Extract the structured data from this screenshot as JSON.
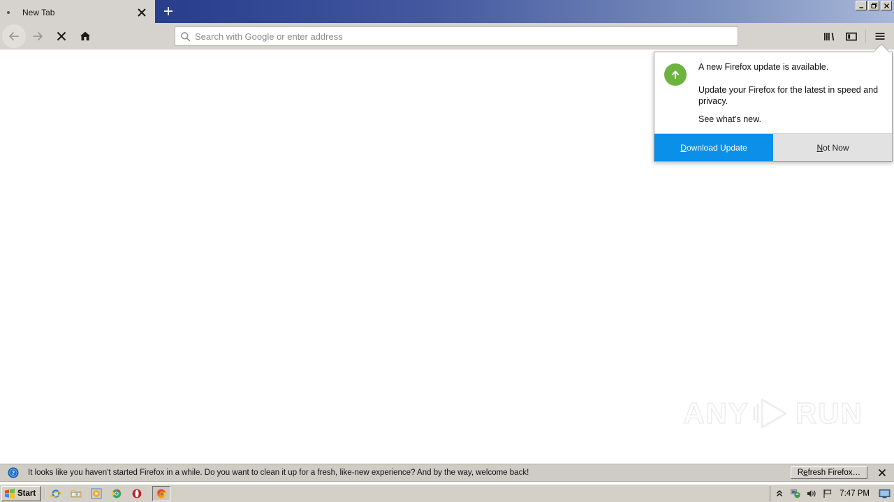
{
  "window": {
    "controls": {
      "minimize": "_",
      "restore": "❐",
      "close": "✕"
    }
  },
  "tabbar": {
    "tabs": [
      {
        "title": "New Tab",
        "close_label": "✕"
      }
    ],
    "new_tab_label": "+"
  },
  "toolbar": {
    "back_label": "Back",
    "forward_label": "Forward",
    "stop_label": "Stop",
    "home_label": "Home",
    "library_label": "Library",
    "sidebar_label": "Sidebars",
    "menu_label": "Open menu"
  },
  "urlbar": {
    "value": "",
    "placeholder": "Search with Google or enter address",
    "icon": "search-icon"
  },
  "update_popup": {
    "icon": "update-arrow-icon",
    "heading": "A new Firefox update is available.",
    "description": "Update your Firefox for the latest in speed and privacy.",
    "link": "See what's new.",
    "primary_button": {
      "prefix": "D",
      "rest": "ownload Update"
    },
    "secondary_button": {
      "prefix": "N",
      "rest": "ot Now"
    },
    "accent_color": "#0a90e8",
    "icon_color": "#6cb33f"
  },
  "notification_bar": {
    "icon": "help-question-icon",
    "message": "It looks like you haven't started Firefox in a while. Do you want to clean it up for a fresh, like-new experience? And by the way, welcome back!",
    "action_button": {
      "prefix": "R",
      "mid": "e",
      "rest": "fresh Firefox…"
    },
    "close_label": "✕"
  },
  "watermark": {
    "left_text": "ANY",
    "right_text": "RUN"
  },
  "taskbar": {
    "start_label": "Start",
    "quick_launch": [
      {
        "name": "internet-explorer-icon"
      },
      {
        "name": "folder-explorer-icon"
      },
      {
        "name": "media-player-icon"
      },
      {
        "name": "chrome-icon"
      },
      {
        "name": "opera-icon"
      }
    ],
    "task_buttons": [
      {
        "name": "firefox-taskbar-button"
      }
    ],
    "tray": {
      "chevron": "«",
      "icons": [
        {
          "name": "network-icon"
        },
        {
          "name": "volume-icon"
        },
        {
          "name": "flag-icon"
        }
      ],
      "clock": "7:47 PM",
      "right_icon": "monitor-icon"
    }
  }
}
